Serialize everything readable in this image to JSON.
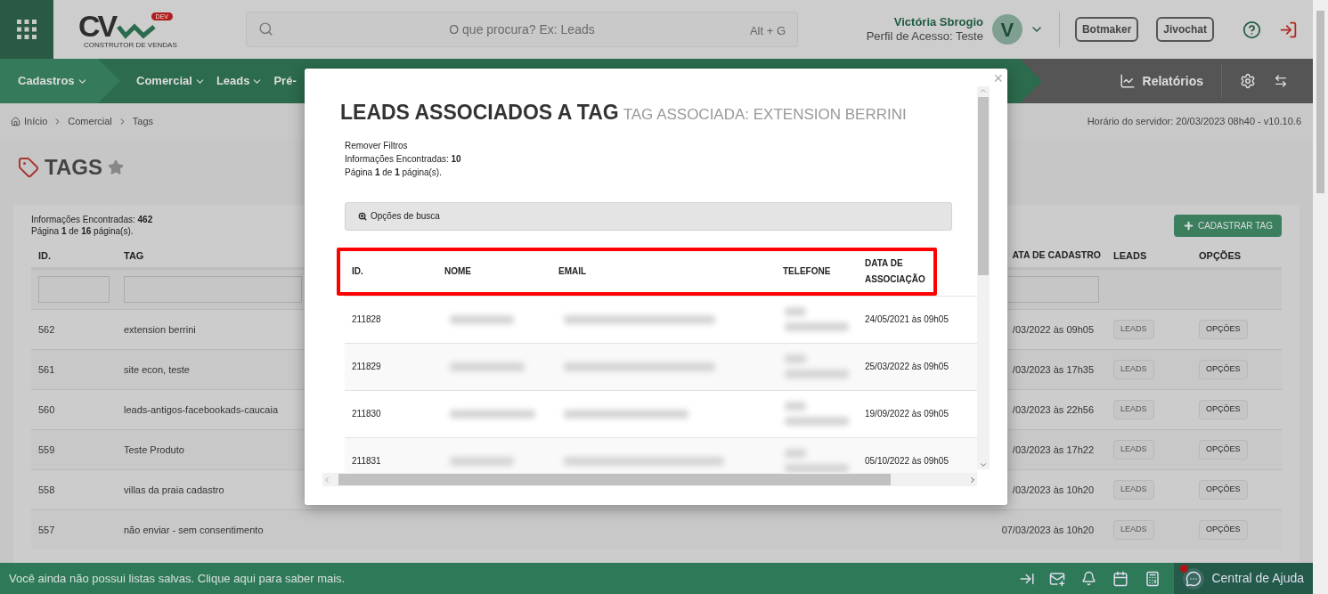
{
  "header": {
    "logo": {
      "letters": "CV",
      "badge": "DEV",
      "tagline": "CONSTRUTOR DE VENDAS"
    },
    "search": {
      "placeholder": "O que procura? Ex: Leads",
      "shortcut": "Alt + G"
    },
    "user": {
      "name": "Victória Sbrogio",
      "profile": "Perfil de Acesso: Teste",
      "avatar_letter": "V"
    },
    "buttons": [
      "Botmaker",
      "Jivochat"
    ]
  },
  "nav": {
    "items": [
      {
        "label": "Cadastros",
        "selected": true,
        "caret": true
      },
      {
        "label": "Comercial",
        "selected": false,
        "caret": true
      },
      {
        "label": "Leads",
        "selected": false,
        "caret": true
      },
      {
        "label": "Pré-",
        "selected": false,
        "caret": false
      }
    ],
    "reports": "Relatórios"
  },
  "breadcrumb": [
    "Início",
    "Comercial",
    "Tags"
  ],
  "server_time": "Horário do servidor: 20/03/2023 08h40 - v10.10.6",
  "page": {
    "title": "TAGS",
    "info_count": "Informações Encontradas: **462**",
    "pagination": "Página **1** de **16** página(s).",
    "add_button": "CADASTRAR TAG",
    "columns": [
      "ID.",
      "TAG",
      "ATA DE CADASTRO",
      "LEADS",
      "OPÇÕES"
    ],
    "rows": [
      {
        "id": "562",
        "tag": "extension berrini",
        "date": "/03/2022 às 09h05",
        "leads": "LEADS",
        "options": "OPÇÕES"
      },
      {
        "id": "561",
        "tag": "site econ, teste",
        "date": "/03/2023 às 17h35",
        "leads": "LEADS",
        "options": "OPÇÕES"
      },
      {
        "id": "560",
        "tag": "leads-antigos-facebookads-caucaia",
        "date": "/03/2023 às 22h56",
        "leads": "LEADS",
        "options": "OPÇÕES"
      },
      {
        "id": "559",
        "tag": "Teste Produto",
        "date": "/03/2023 às 17h22",
        "leads": "LEADS",
        "options": "OPÇÕES"
      },
      {
        "id": "558",
        "tag": "villas da praia cadastro",
        "date": "/03/2023 às 10h20",
        "leads": "LEADS",
        "options": "OPÇÕES"
      },
      {
        "id": "557",
        "tag": "não enviar - sem consentimento",
        "date": "07/03/2023 às 10h20",
        "leads": "LEADS",
        "options": "OPÇÕES"
      }
    ]
  },
  "modal": {
    "close": "×",
    "title": "LEADS ASSOCIADOS A TAG",
    "subtitle": "TAG ASSOCIADA: EXTENSION BERRINI",
    "remove_filters": "Remover Filtros",
    "info_count": "Informações Encontradas: **10**",
    "pagination": "Página **1** de **1** página(s).",
    "search_options": "Opções de busca",
    "columns": [
      "ID.",
      "NOME",
      "EMAIL",
      "TELEFONE",
      "DATA DE ASSOCIAÇÃO"
    ],
    "rows": [
      {
        "id": "211828",
        "date": "24/05/2021 às 09h05"
      },
      {
        "id": "211829",
        "date": "25/03/2022 às 09h05"
      },
      {
        "id": "211830",
        "date": "19/09/2022 às 09h05"
      },
      {
        "id": "211831",
        "date": "05/10/2022 às 09h05"
      }
    ]
  },
  "footer": {
    "message": "Você ainda não possui listas salvas. Clique aqui para saber mais.",
    "help": "Central de Ajuda"
  }
}
